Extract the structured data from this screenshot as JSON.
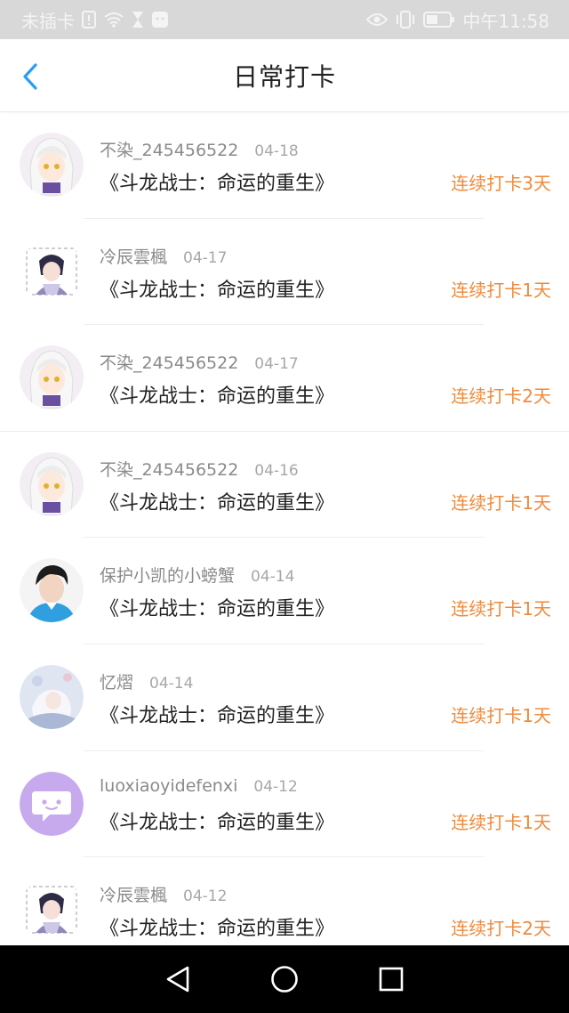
{
  "status_bar": {
    "carrier": "未插卡",
    "time": "中午11:58"
  },
  "header": {
    "title": "日常打卡",
    "back_icon": "chevron-left-icon",
    "accent": "#2a9df4"
  },
  "checkins": [
    {
      "user": "不染_245456522",
      "date": "04-18",
      "book": "《斗龙战士：命运的重生》",
      "streak": "连续打卡3天",
      "avatar": "anime-white-hair"
    },
    {
      "user": "冷辰雲楓",
      "date": "04-17",
      "book": "《斗龙战士：命运的重生》",
      "streak": "连续打卡1天",
      "avatar": "anime-ink-style"
    },
    {
      "user": "不染_245456522",
      "date": "04-17",
      "book": "《斗龙战士：命运的重生》",
      "streak": "连续打卡2天",
      "avatar": "anime-white-hair"
    },
    {
      "user": "不染_245456522",
      "date": "04-16",
      "book": "《斗龙战士：命运的重生》",
      "streak": "连续打卡1天",
      "avatar": "anime-white-hair"
    },
    {
      "user": "保护小凯的小螃蟹",
      "date": "04-14",
      "book": "《斗龙战士：命运的重生》",
      "streak": "连续打卡1天",
      "avatar": "photo-person-blue"
    },
    {
      "user": "忆熠",
      "date": "04-14",
      "book": "《斗龙战士：命运的重生》",
      "streak": "连续打卡1天",
      "avatar": "anime-pastel"
    },
    {
      "user": "luoxiaoyidefenxi",
      "date": "04-12",
      "book": "《斗龙战士：命运的重生》",
      "streak": "连续打卡1天",
      "avatar": "default-chat-purple"
    },
    {
      "user": "冷辰雲楓",
      "date": "04-12",
      "book": "《斗龙战士：命运的重生》",
      "streak": "连续打卡2天",
      "avatar": "anime-ink-style"
    }
  ],
  "colors": {
    "streak": "#f08a3a",
    "username": "#8a8a8a",
    "date": "#a7a7a7",
    "book": "#222222"
  },
  "nav": [
    "back-triangle-icon",
    "home-circle-icon",
    "recents-square-icon"
  ]
}
